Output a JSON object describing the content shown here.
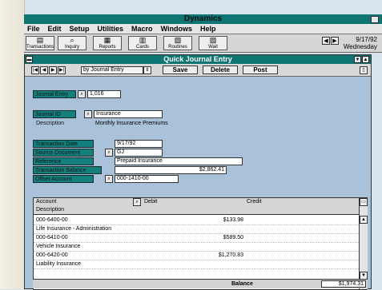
{
  "app": {
    "title": "Dynamics",
    "menu": [
      "File",
      "Edit",
      "Setup",
      "Utilities",
      "Macro",
      "Windows",
      "Help"
    ],
    "toolbar": [
      {
        "label": "Transactions",
        "icon": "transactions-icon"
      },
      {
        "label": "Inquiry",
        "icon": "inquiry-icon"
      },
      {
        "label": "Reports",
        "icon": "reports-icon"
      },
      {
        "label": "Cards",
        "icon": "cards-icon"
      },
      {
        "label": "Routines",
        "icon": "routines-icon"
      },
      {
        "label": "Wait",
        "icon": "wait-icon"
      }
    ],
    "date": "9/17/92",
    "day": "Wednesday"
  },
  "window": {
    "title": "Quick Journal Entry",
    "browse_by": "by Journal Entry",
    "buttons": {
      "save": "Save",
      "delete": "Delete",
      "post": "Post"
    }
  },
  "form": {
    "journal_entry": {
      "label": "Journal Entry",
      "value": "1,016"
    },
    "journal_id": {
      "label": "Journal ID",
      "value": "Insurance"
    },
    "description": {
      "label": "Description",
      "value": "Monthly Insurance Premiums"
    },
    "transaction_date": {
      "label": "Transaction Date",
      "value": "9/17/92"
    },
    "source_document": {
      "label": "Source Document",
      "value": "GJ"
    },
    "reference": {
      "label": "Reference",
      "value": "Prepaid Insurance"
    },
    "transaction_balance": {
      "label": "Transaction Balance",
      "value": "$2,862.41"
    },
    "offset_account": {
      "label": "Offset Account",
      "value": "000-1410-00"
    }
  },
  "grid": {
    "headers": {
      "account": "Account",
      "debit": "Debit",
      "credit": "Credit",
      "description": "Description"
    },
    "rows": [
      {
        "account": "000-6400-00",
        "debit": "$133.98"
      },
      {
        "account": "Life Insurance - Administration",
        "debit": ""
      },
      {
        "account": "000-6410-00",
        "debit": "$589.50"
      },
      {
        "account": "Vehicle Insurance",
        "debit": ""
      },
      {
        "account": "000-6420-00",
        "debit": "$1,270.83"
      },
      {
        "account": "Liability Insurance",
        "debit": ""
      }
    ],
    "balance_label": "Balance",
    "balance_value": "$1,974.31"
  }
}
